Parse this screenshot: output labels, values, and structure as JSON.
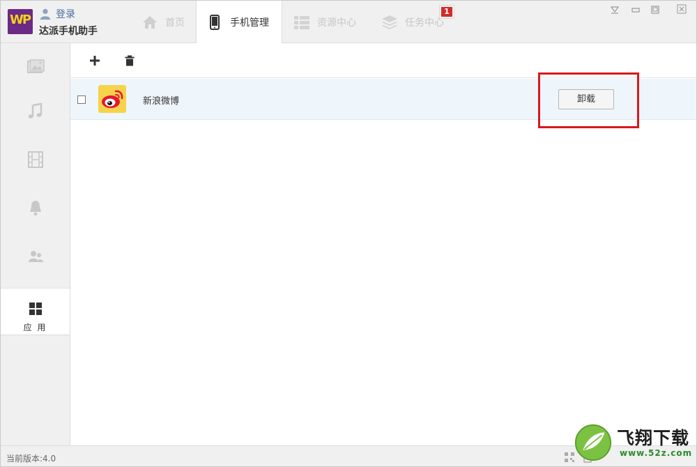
{
  "app": {
    "logo_text": "WP",
    "title": "达派手机助手",
    "login_label": "登录"
  },
  "tabs": [
    {
      "label": "首页",
      "icon": "home-icon",
      "active": false
    },
    {
      "label": "手机管理",
      "icon": "phone-icon",
      "active": true
    },
    {
      "label": "资源中心",
      "icon": "list-icon",
      "active": false
    },
    {
      "label": "任务中心",
      "icon": "layers-icon",
      "active": false,
      "badge": "1"
    }
  ],
  "sidebar": {
    "items": [
      {
        "icon": "photo-icon"
      },
      {
        "icon": "music-icon"
      },
      {
        "icon": "film-icon"
      },
      {
        "icon": "bell-icon"
      },
      {
        "icon": "contacts-icon"
      }
    ],
    "active": {
      "icon": "apps-grid-icon",
      "label": "应 用"
    }
  },
  "toolbar": {
    "add_icon": "plus-icon",
    "delete_icon": "trash-icon"
  },
  "apps": [
    {
      "name": "新浪微博",
      "icon": "weibo-icon",
      "checked": false,
      "action_label": "卸载"
    }
  ],
  "status": {
    "version": "当前版本:4.0"
  },
  "watermark": {
    "text": "飞翔下载",
    "url": "www.52z.com"
  },
  "colors": {
    "accent_red": "#d7191c",
    "logo_purple": "#6b2a86",
    "row_highlight": "#eef6fc"
  }
}
